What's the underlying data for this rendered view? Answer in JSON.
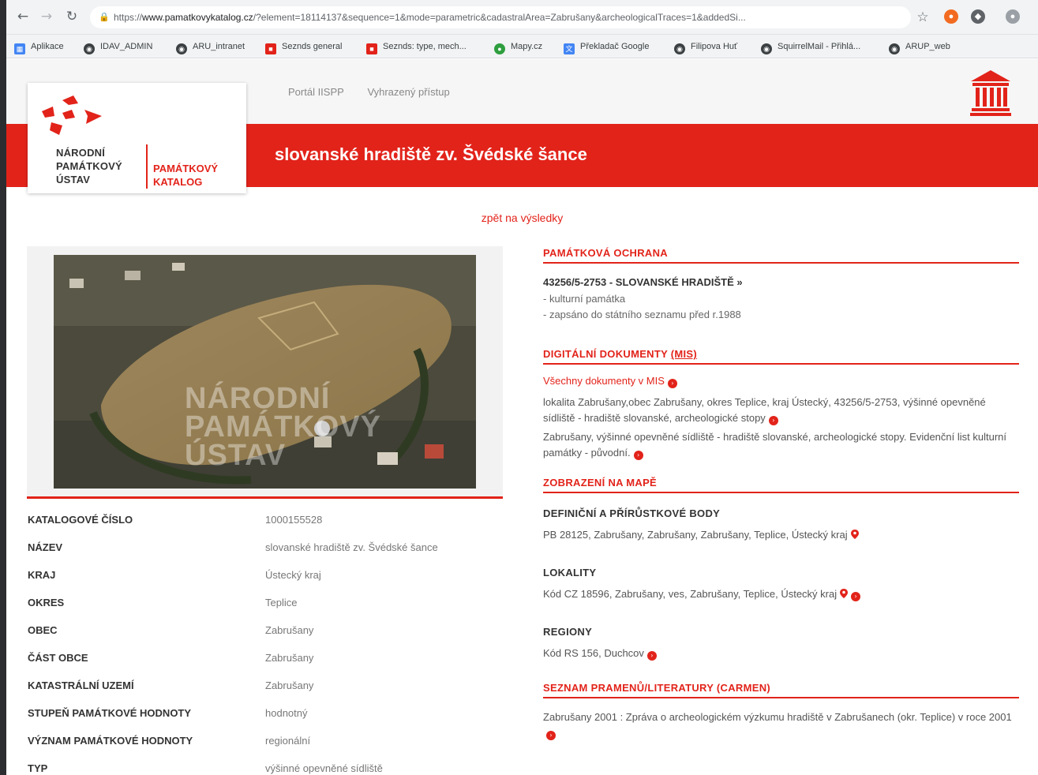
{
  "browser": {
    "url_scheme": "https://",
    "url_host": "www.pamatkovykatalog.cz",
    "url_rest": "/?element=18114137&sequence=1&mode=parametric&cadastralArea=Zabrušany&archeologicalTraces=1&addedSi...",
    "bookmarks": [
      {
        "label": "Aplikace",
        "icon": "apps-icon",
        "color": "#4285f4"
      },
      {
        "label": "IDAV_ADMIN",
        "icon": "globe-icon",
        "color": "#3c4043"
      },
      {
        "label": "ARU_intranet",
        "icon": "globe-icon",
        "color": "#3c4043"
      },
      {
        "label": "Seznds general",
        "icon": "bookmark-icon",
        "color": "#e2231a"
      },
      {
        "label": "Seznds: type, mech...",
        "icon": "bookmark-icon",
        "color": "#e2231a"
      },
      {
        "label": "Mapy.cz",
        "icon": "map-icon",
        "color": "#2e9e3f"
      },
      {
        "label": "Překladač Google",
        "icon": "translate-icon",
        "color": "#4285f4"
      },
      {
        "label": "Filipova Huť",
        "icon": "globe-icon",
        "color": "#3c4043"
      },
      {
        "label": "SquirrelMail - Přihlá...",
        "icon": "globe-icon",
        "color": "#3c4043"
      },
      {
        "label": "ARUP_web",
        "icon": "globe-icon",
        "color": "#3c4043"
      }
    ]
  },
  "header": {
    "org_name": [
      "NÁRODNÍ",
      "PAMÁTKOVÝ",
      "ÚSTAV"
    ],
    "catalog_label": [
      "PAMÁTKOVÝ",
      "KATALOG"
    ],
    "nav": [
      "Portál IISPP",
      "Vyhrazený přístup"
    ],
    "title": "slovanské hradiště zv. Švédské šance"
  },
  "back_link": "zpět na výsledky",
  "photo": {
    "watermark": [
      "NÁRODNÍ",
      "PAMÁTKOVÝ",
      "ÚSTAV"
    ]
  },
  "attributes": [
    {
      "label": "KATALOGOVÉ ČÍSLO",
      "value": "1000155528"
    },
    {
      "label": "NÁZEV",
      "value": "slovanské hradiště zv. Švédské šance"
    },
    {
      "label": "KRAJ",
      "value": "Ústecký kraj"
    },
    {
      "label": "OKRES",
      "value": "Teplice"
    },
    {
      "label": "OBEC",
      "value": "Zabrušany"
    },
    {
      "label": "ČÁST OBCE",
      "value": "Zabrušany"
    },
    {
      "label": "KATASTRÁLNÍ UZEMÍ",
      "value": "Zabrušany"
    },
    {
      "label": "STUPEŇ PAMÁTKOVÉ HODNOTY",
      "value": "hodnotný"
    },
    {
      "label": "VÝZNAM PAMÁTKOVÉ HODNOTY",
      "value": "regionální"
    },
    {
      "label": "TYP",
      "value": "výšinné opevněné sídliště"
    }
  ],
  "right": {
    "protection": {
      "heading": "PAMÁTKOVÁ OCHRANA",
      "entry_title": "43256/5-2753 - SLOVANSKÉ HRADIŠTĚ »",
      "lines": [
        "- kulturní památka",
        "- zapsáno do státního seznamu před r.1988"
      ]
    },
    "documents": {
      "heading_prefix": "DIGITÁLNÍ DOKUMENTY ",
      "heading_link": "(MIS)",
      "all_link": "Všechny dokumenty v MIS",
      "items": [
        "lokalita Zabrušany,obec Zabrušany, okres Teplice, kraj Ústecký, 43256/5-2753, výšinné opevněné sídliště - hradiště slovanské, archeologické stopy",
        "Zabrušany, výšinné opevněné sídliště - hradiště slovanské, archeologické stopy. Evidenční list kulturní památky - původní."
      ]
    },
    "map": {
      "heading": "ZOBRAZENÍ NA MAPĚ",
      "points_heading": "DEFINIČNÍ A PŘÍRŮSTKOVÉ BODY",
      "points_text": "PB 28125, Zabrušany, Zabrušany, Zabrušany, Teplice, Ústecký kraj",
      "locality_heading": "LOKALITY",
      "locality_text": "Kód CZ 18596, Zabrušany, ves, Zabrušany, Teplice, Ústecký kraj",
      "regions_heading": "REGIONY",
      "regions_text": "Kód RS 156, Duchcov"
    },
    "sources": {
      "heading": "SEZNAM PRAMENŮ/LITERATURY (CARMEN)",
      "text": "Zabrušany 2001 : Zpráva o archeologickém výzkumu hradiště v Zabrušanech (okr. Teplice) v roce 2001"
    }
  },
  "colors": {
    "accent": "#e2231a",
    "label": "#333333",
    "value": "#777777"
  }
}
